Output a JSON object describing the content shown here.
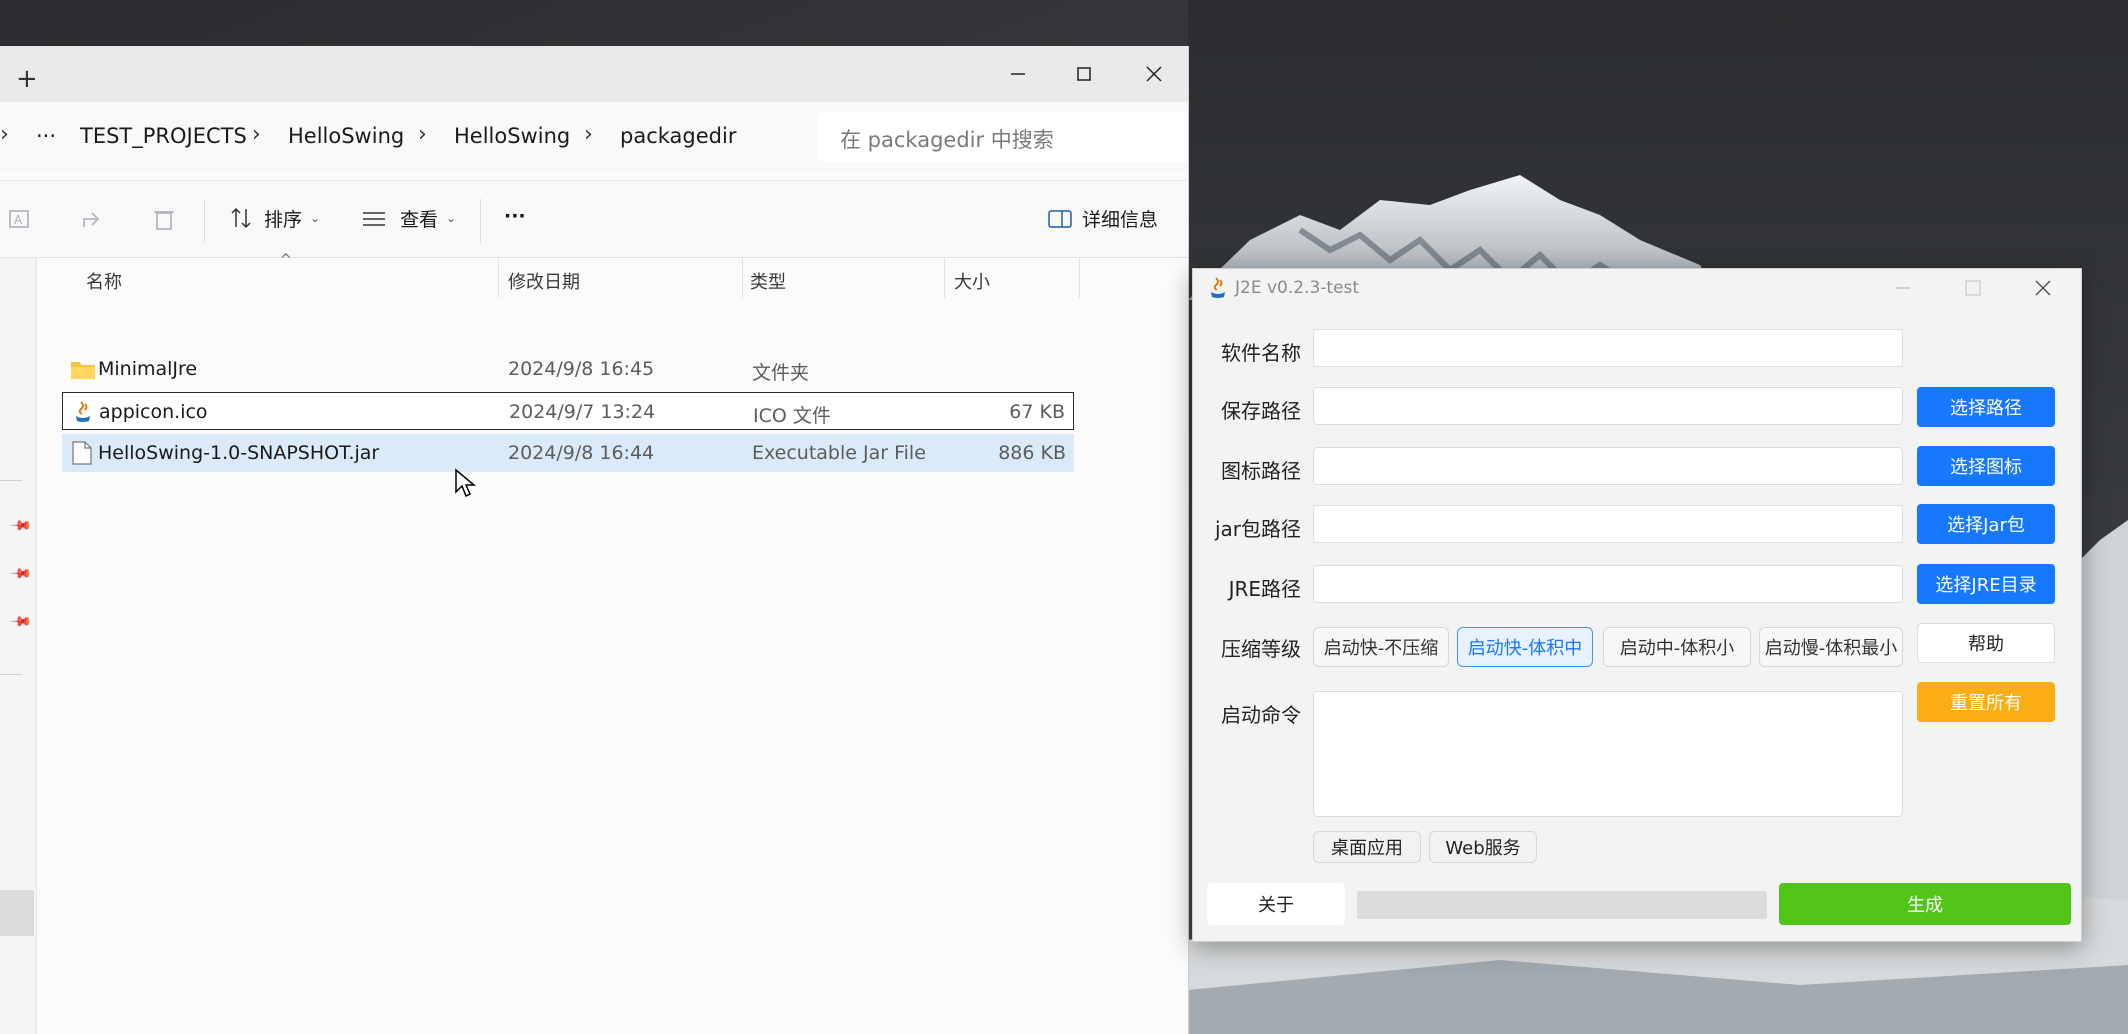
{
  "explorer": {
    "breadcrumbs": [
      "TEST_PROJECTS",
      "HelloSwing",
      "HelloSwing",
      "packagedir"
    ],
    "ellipsis": "···",
    "search_placeholder": "在 packagedir 中搜索",
    "toolbar": {
      "sort_label": "排序",
      "view_label": "查看",
      "more_label": "···",
      "details_label": "详细信息"
    },
    "columns": {
      "name": "名称",
      "date": "修改日期",
      "type": "类型",
      "size": "大小"
    },
    "files": [
      {
        "name": "MinimalJre",
        "date": "2024/9/8 16:45",
        "type": "文件夹",
        "size": "",
        "icon": "folder-icon"
      },
      {
        "name": "appicon.ico",
        "date": "2024/9/7 13:24",
        "type": "ICO 文件",
        "size": "67 KB",
        "icon": "java-icon"
      },
      {
        "name": "HelloSwing-1.0-SNAPSHOT.jar",
        "date": "2024/9/8 16:44",
        "type": "Executable Jar File",
        "size": "886 KB",
        "icon": "file-icon"
      }
    ]
  },
  "j2e": {
    "title": "J2E v0.2.3-test",
    "labels": {
      "app_name": "软件名称",
      "save_path": "保存路径",
      "icon_path": "图标路径",
      "jar_path": "jar包路径",
      "jre_path": "JRE路径",
      "compress": "压缩等级",
      "command": "启动命令"
    },
    "buttons": {
      "choose_path": "选择路径",
      "choose_icon": "选择图标",
      "choose_jar": "选择Jar包",
      "choose_jre": "选择JRE目录",
      "help": "帮助",
      "reset": "重置所有",
      "about": "关于",
      "generate": "生成"
    },
    "compress_options": [
      "启动快-不压缩",
      "启动快-体积中",
      "启动中-体积小",
      "启动慢-体积最小"
    ],
    "compress_selected": "启动快-体积中",
    "app_types": [
      "桌面应用",
      "Web服务"
    ],
    "colors": {
      "primary": "#1677ff",
      "warning": "#faad14",
      "success": "#52c41a"
    }
  }
}
